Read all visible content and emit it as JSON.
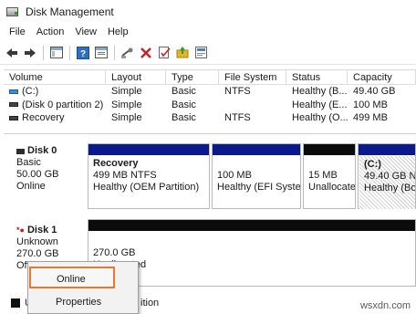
{
  "window": {
    "title": "Disk Management"
  },
  "menu": [
    "File",
    "Action",
    "View",
    "Help"
  ],
  "toolbar": {
    "icons": [
      "back-arrow-icon",
      "forward-arrow-icon",
      "console-tree-icon",
      "help-icon",
      "properties-icon",
      "connect-icon",
      "delete-icon",
      "check-icon",
      "folder-up-icon",
      "rescan-icon"
    ],
    "colors": {
      "delete": "#c1272d",
      "folder": "#e6b323",
      "arrow": "#3a3a3a"
    }
  },
  "volume_table": {
    "headers": [
      "Volume",
      "Layout",
      "Type",
      "File System",
      "Status",
      "Capacity"
    ],
    "rows": [
      {
        "volume": "(C:)",
        "layout": "Simple",
        "type": "Basic",
        "fs": "NTFS",
        "status": "Healthy (B...",
        "capacity": "49.40 GB"
      },
      {
        "volume": "(Disk 0 partition 2)",
        "layout": "Simple",
        "type": "Basic",
        "fs": "",
        "status": "Healthy (E...",
        "capacity": "100 MB"
      },
      {
        "volume": "Recovery",
        "layout": "Simple",
        "type": "Basic",
        "fs": "NTFS",
        "status": "Healthy (O...",
        "capacity": "499 MB"
      }
    ]
  },
  "disk0": {
    "name": "Disk 0",
    "type": "Basic",
    "size": "50.00 GB",
    "state": "Online",
    "partitions": [
      {
        "title": "Recovery",
        "line1": "499 MB NTFS",
        "line2": "Healthy (OEM Partition)"
      },
      {
        "title": "",
        "line1": "100 MB",
        "line2": "Healthy (EFI Systen"
      },
      {
        "title": "",
        "line1": "15 MB",
        "line2": "Unallocate"
      },
      {
        "title": "(C:)",
        "line1": "49.40 GB NT",
        "line2": "Healthy (Boo"
      }
    ]
  },
  "disk1": {
    "name": "Disk 1",
    "type": "Unknown",
    "size": "270.0 GB",
    "state": "Offline",
    "partition": {
      "line1": "270.0 GB",
      "line2": "Unallocated"
    }
  },
  "context_menu": {
    "items": [
      "Online",
      "Properties"
    ],
    "highlight_color": "#e8782a"
  },
  "legend": {
    "first": "U",
    "second": "ition"
  },
  "watermark": "wsxdn.com"
}
